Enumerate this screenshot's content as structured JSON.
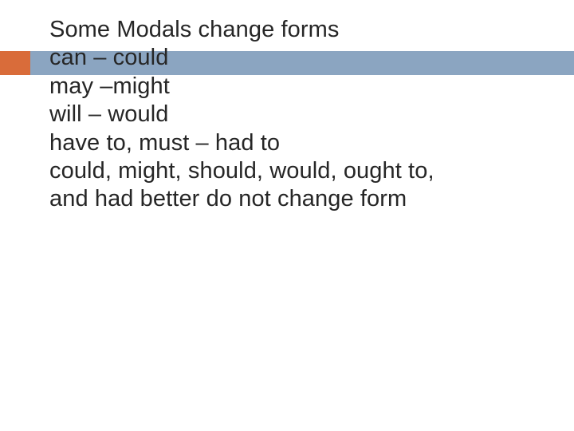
{
  "slide": {
    "lines": [
      "Some Modals change forms",
      "can – could",
      "may –might",
      "will – would",
      "have to, must – had to",
      "could, might, should, would, ought to,",
      "and had better do not change form"
    ]
  }
}
